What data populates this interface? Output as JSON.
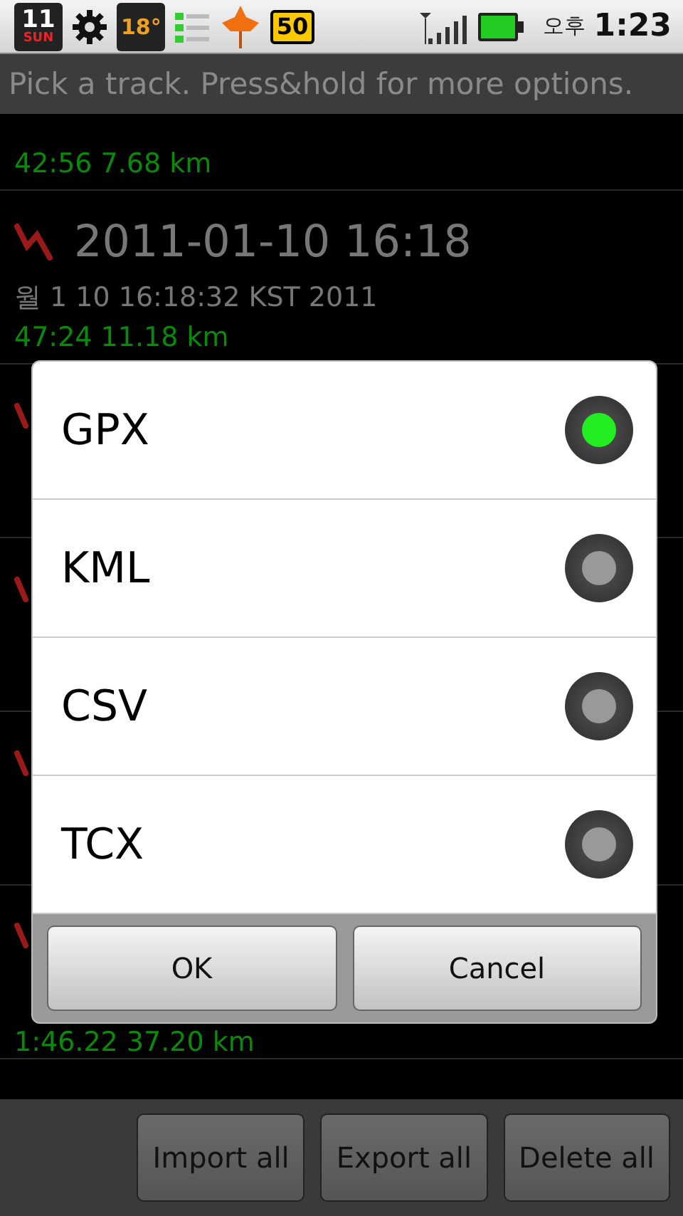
{
  "status_bar": {
    "calendar_day": "11",
    "calendar_weekday": "SUN",
    "temperature": "18°",
    "battery_badge": "50",
    "period": "오후",
    "time": "1:23"
  },
  "title_bar": {
    "title": "Pick a track. Press&hold for more options."
  },
  "tracks": [
    {
      "kind": "stub",
      "stats": "42:56  7.68 km"
    },
    {
      "kind": "track",
      "title": "2011-01-10 16:18",
      "subtitle": "월 1 10 16:18:32 KST 2011",
      "stats": "47:24  11.18 km"
    },
    {
      "kind": "covered"
    },
    {
      "kind": "covered"
    },
    {
      "kind": "covered"
    },
    {
      "kind": "covered",
      "stats": "1:46.22  37.20 km"
    },
    {
      "kind": "blank"
    }
  ],
  "dialog": {
    "options": [
      {
        "label": "GPX",
        "selected": true
      },
      {
        "label": "KML",
        "selected": false
      },
      {
        "label": "CSV",
        "selected": false
      },
      {
        "label": "TCX",
        "selected": false
      }
    ],
    "buttons": [
      "OK",
      "Cancel"
    ]
  },
  "toolbar": {
    "buttons": [
      "Import all",
      "Export all",
      "Delete all"
    ]
  }
}
